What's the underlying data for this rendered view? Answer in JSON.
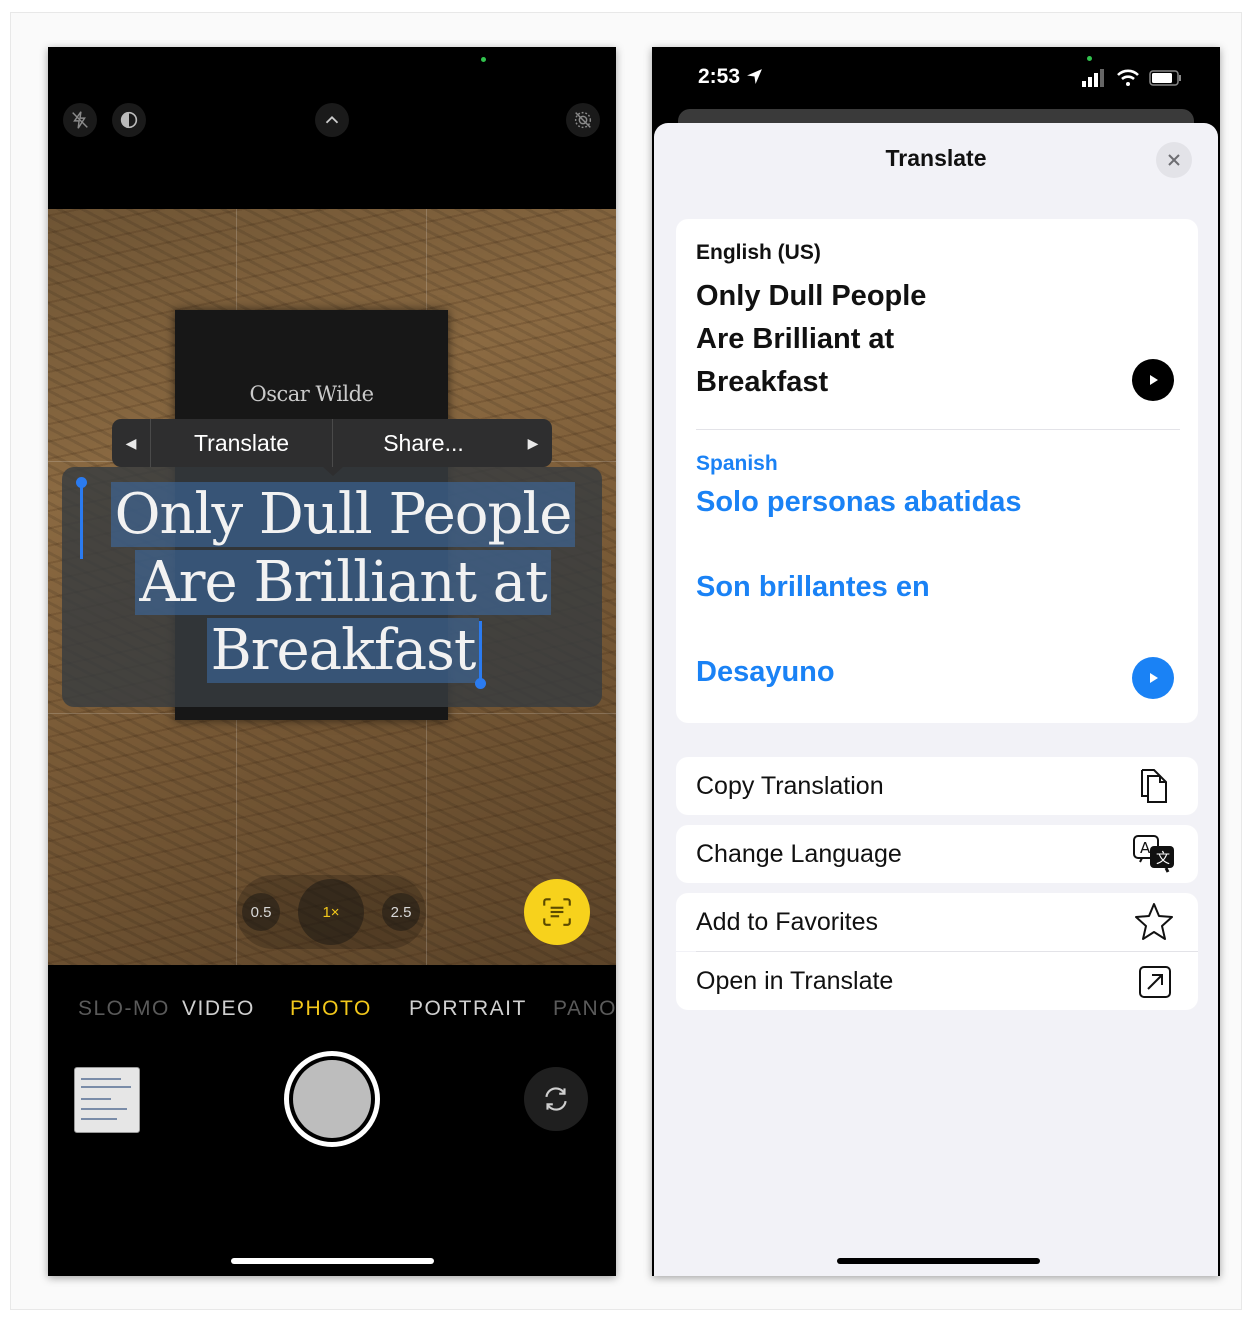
{
  "camera": {
    "book_author": "Oscar Wilde",
    "context_menu": {
      "left_arrow": "◀",
      "translate_label": "Translate",
      "share_label": "Share...",
      "right_arrow": "▶"
    },
    "selected_text": [
      "Only Dull People",
      "Are Brilliant at",
      "Breakfast"
    ],
    "zoom": {
      "options": [
        "0.5",
        "1×",
        "2.5"
      ],
      "active": "1×"
    },
    "modes": [
      "SLO-MO",
      "VIDEO",
      "PHOTO",
      "PORTRAIT",
      "PANO"
    ],
    "active_mode": "PHOTO",
    "accent_color": "#f3c81b",
    "icons": [
      "flash-off-icon",
      "live-photo-icon",
      "chevron-up-icon",
      "live-off-icon",
      "live-text-icon",
      "camera-flip-icon"
    ]
  },
  "translate": {
    "status_time": "2:53",
    "title": "Translate",
    "close_icon": "close-icon",
    "source": {
      "language": "English (US)",
      "lines": [
        "Only Dull People",
        "Are Brilliant at",
        "Breakfast"
      ]
    },
    "target": {
      "language": "Spanish",
      "lines": [
        "Solo personas abatidas",
        "Son brillantes en",
        "Desayuno"
      ]
    },
    "actions": [
      {
        "label": "Copy Translation",
        "icon": "copy-icon"
      },
      {
        "label": "Change Language",
        "icon": "change-language-icon"
      },
      {
        "label": "Add to Favorites",
        "icon": "star-icon"
      },
      {
        "label": "Open in Translate",
        "icon": "open-external-icon"
      }
    ],
    "accent_color": "#1a82f5"
  }
}
